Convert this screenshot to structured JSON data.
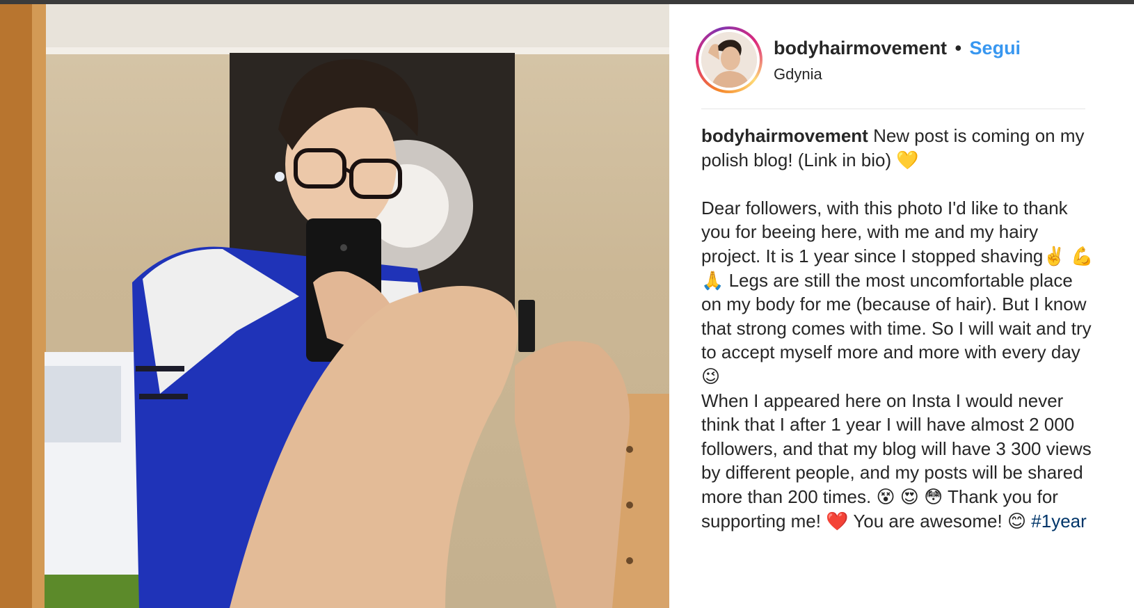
{
  "post": {
    "username": "bodyhairmovement",
    "separator": "•",
    "follow_label": "Segui",
    "location": "Gdynia",
    "avatar_icon": "profile-avatar",
    "caption": {
      "author": "bodyhairmovement",
      "line1": "New post is coming on my polish blog! (Link in bio) 💛",
      "paragraph2": "Dear followers, with this photo I'd like to thank you for beeing here, with me and my hairy project. It is 1 year since I stopped shaving✌️ 💪 🙏  Legs are still the most uncomfortable place on my body for me (because of hair). But I know that strong comes with time. So I will wait and try to accept myself more and more with every day 😉",
      "paragraph3": "When I appeared here on Insta I would never think that I after 1 year I will have almost 2 000 followers, and that my blog will have 3 300 views by different people, and my posts will be shared more than 200 times. 😵 😍 😳  Thank you for supporting me! ❤️ You are awesome! 😊 ",
      "hashtag": "#1year"
    }
  },
  "colors": {
    "link_blue": "#3897f0",
    "hashtag_blue": "#003569",
    "text": "#262626",
    "divider": "#e6e6e6"
  }
}
